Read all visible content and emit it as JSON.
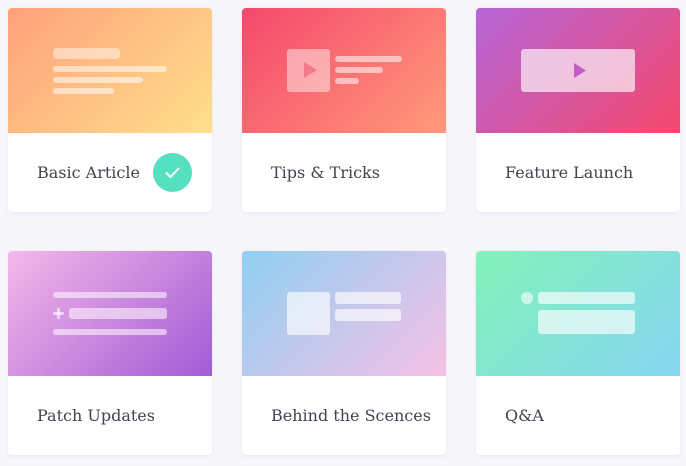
{
  "templates": [
    {
      "title": "Basic Article",
      "selected": true,
      "gradient": [
        "#ffa07a",
        "#ffe08c"
      ]
    },
    {
      "title": "Tips & Tricks",
      "selected": false,
      "gradient": [
        "#f5486c",
        "#ff9a7a"
      ]
    },
    {
      "title": "Feature Launch",
      "selected": false,
      "gradient": [
        "#b565d8",
        "#f5486c"
      ]
    },
    {
      "title": "Patch Updates",
      "selected": false,
      "gradient": [
        "#f5b8e8",
        "#a25bd6"
      ]
    },
    {
      "title": "Behind the Scences",
      "selected": false,
      "gradient": [
        "#8fd0f2",
        "#f7c0e6"
      ]
    },
    {
      "title": "Q&A",
      "selected": false,
      "gradient": [
        "#82f2b8",
        "#86d6f2"
      ]
    }
  ],
  "accent_color": "#55e0bf",
  "icons": {
    "selected": "checkmark-icon",
    "video": "play-icon",
    "add": "plus-icon"
  }
}
